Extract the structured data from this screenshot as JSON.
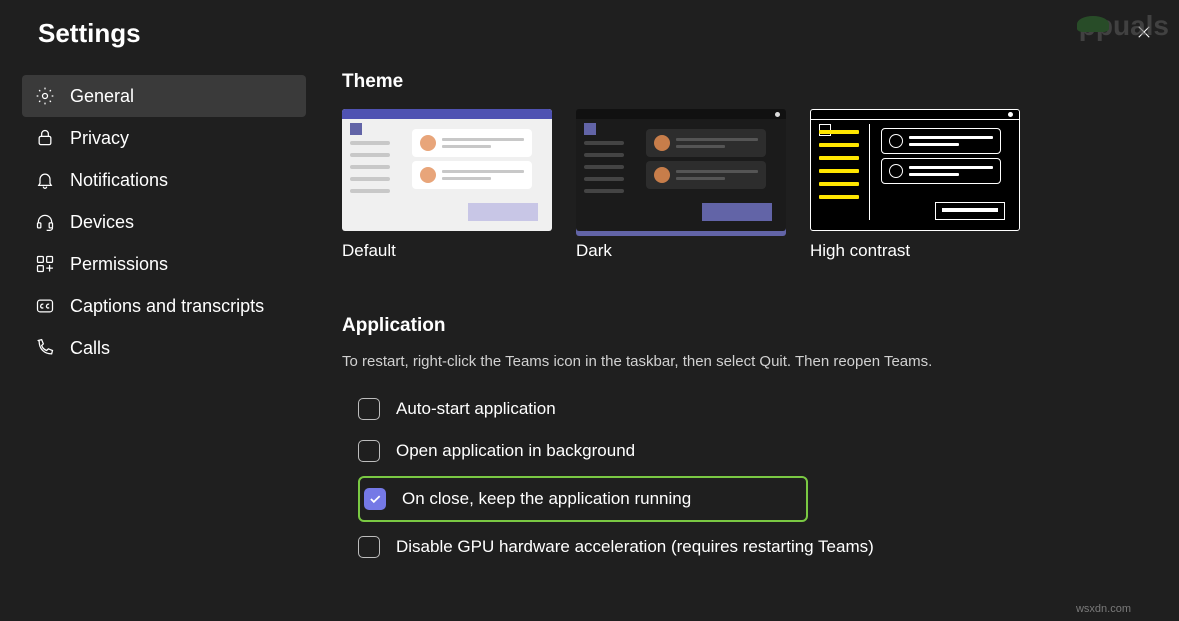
{
  "title": "Settings",
  "watermark": {
    "text": "ppuals"
  },
  "sidebar": {
    "items": [
      {
        "label": "General",
        "icon": "gear-icon",
        "active": true
      },
      {
        "label": "Privacy",
        "icon": "lock-icon",
        "active": false
      },
      {
        "label": "Notifications",
        "icon": "bell-icon",
        "active": false
      },
      {
        "label": "Devices",
        "icon": "headset-icon",
        "active": false
      },
      {
        "label": "Permissions",
        "icon": "apps-icon",
        "active": false
      },
      {
        "label": "Captions and transcripts",
        "icon": "cc-icon",
        "active": false
      },
      {
        "label": "Calls",
        "icon": "phone-icon",
        "active": false
      }
    ]
  },
  "theme": {
    "heading": "Theme",
    "options": [
      {
        "label": "Default",
        "selected": false,
        "id": "default"
      },
      {
        "label": "Dark",
        "selected": true,
        "id": "dark"
      },
      {
        "label": "High contrast",
        "selected": false,
        "id": "high-contrast"
      }
    ]
  },
  "application": {
    "heading": "Application",
    "description": "To restart, right-click the Teams icon in the taskbar, then select Quit. Then reopen Teams.",
    "options": [
      {
        "label": "Auto-start application",
        "checked": false,
        "highlighted": false
      },
      {
        "label": "Open application in background",
        "checked": false,
        "highlighted": false
      },
      {
        "label": "On close, keep the application running",
        "checked": true,
        "highlighted": true
      },
      {
        "label": "Disable GPU hardware acceleration (requires restarting Teams)",
        "checked": false,
        "highlighted": false
      }
    ]
  },
  "footer": {
    "tag": "wsxdn.com"
  }
}
